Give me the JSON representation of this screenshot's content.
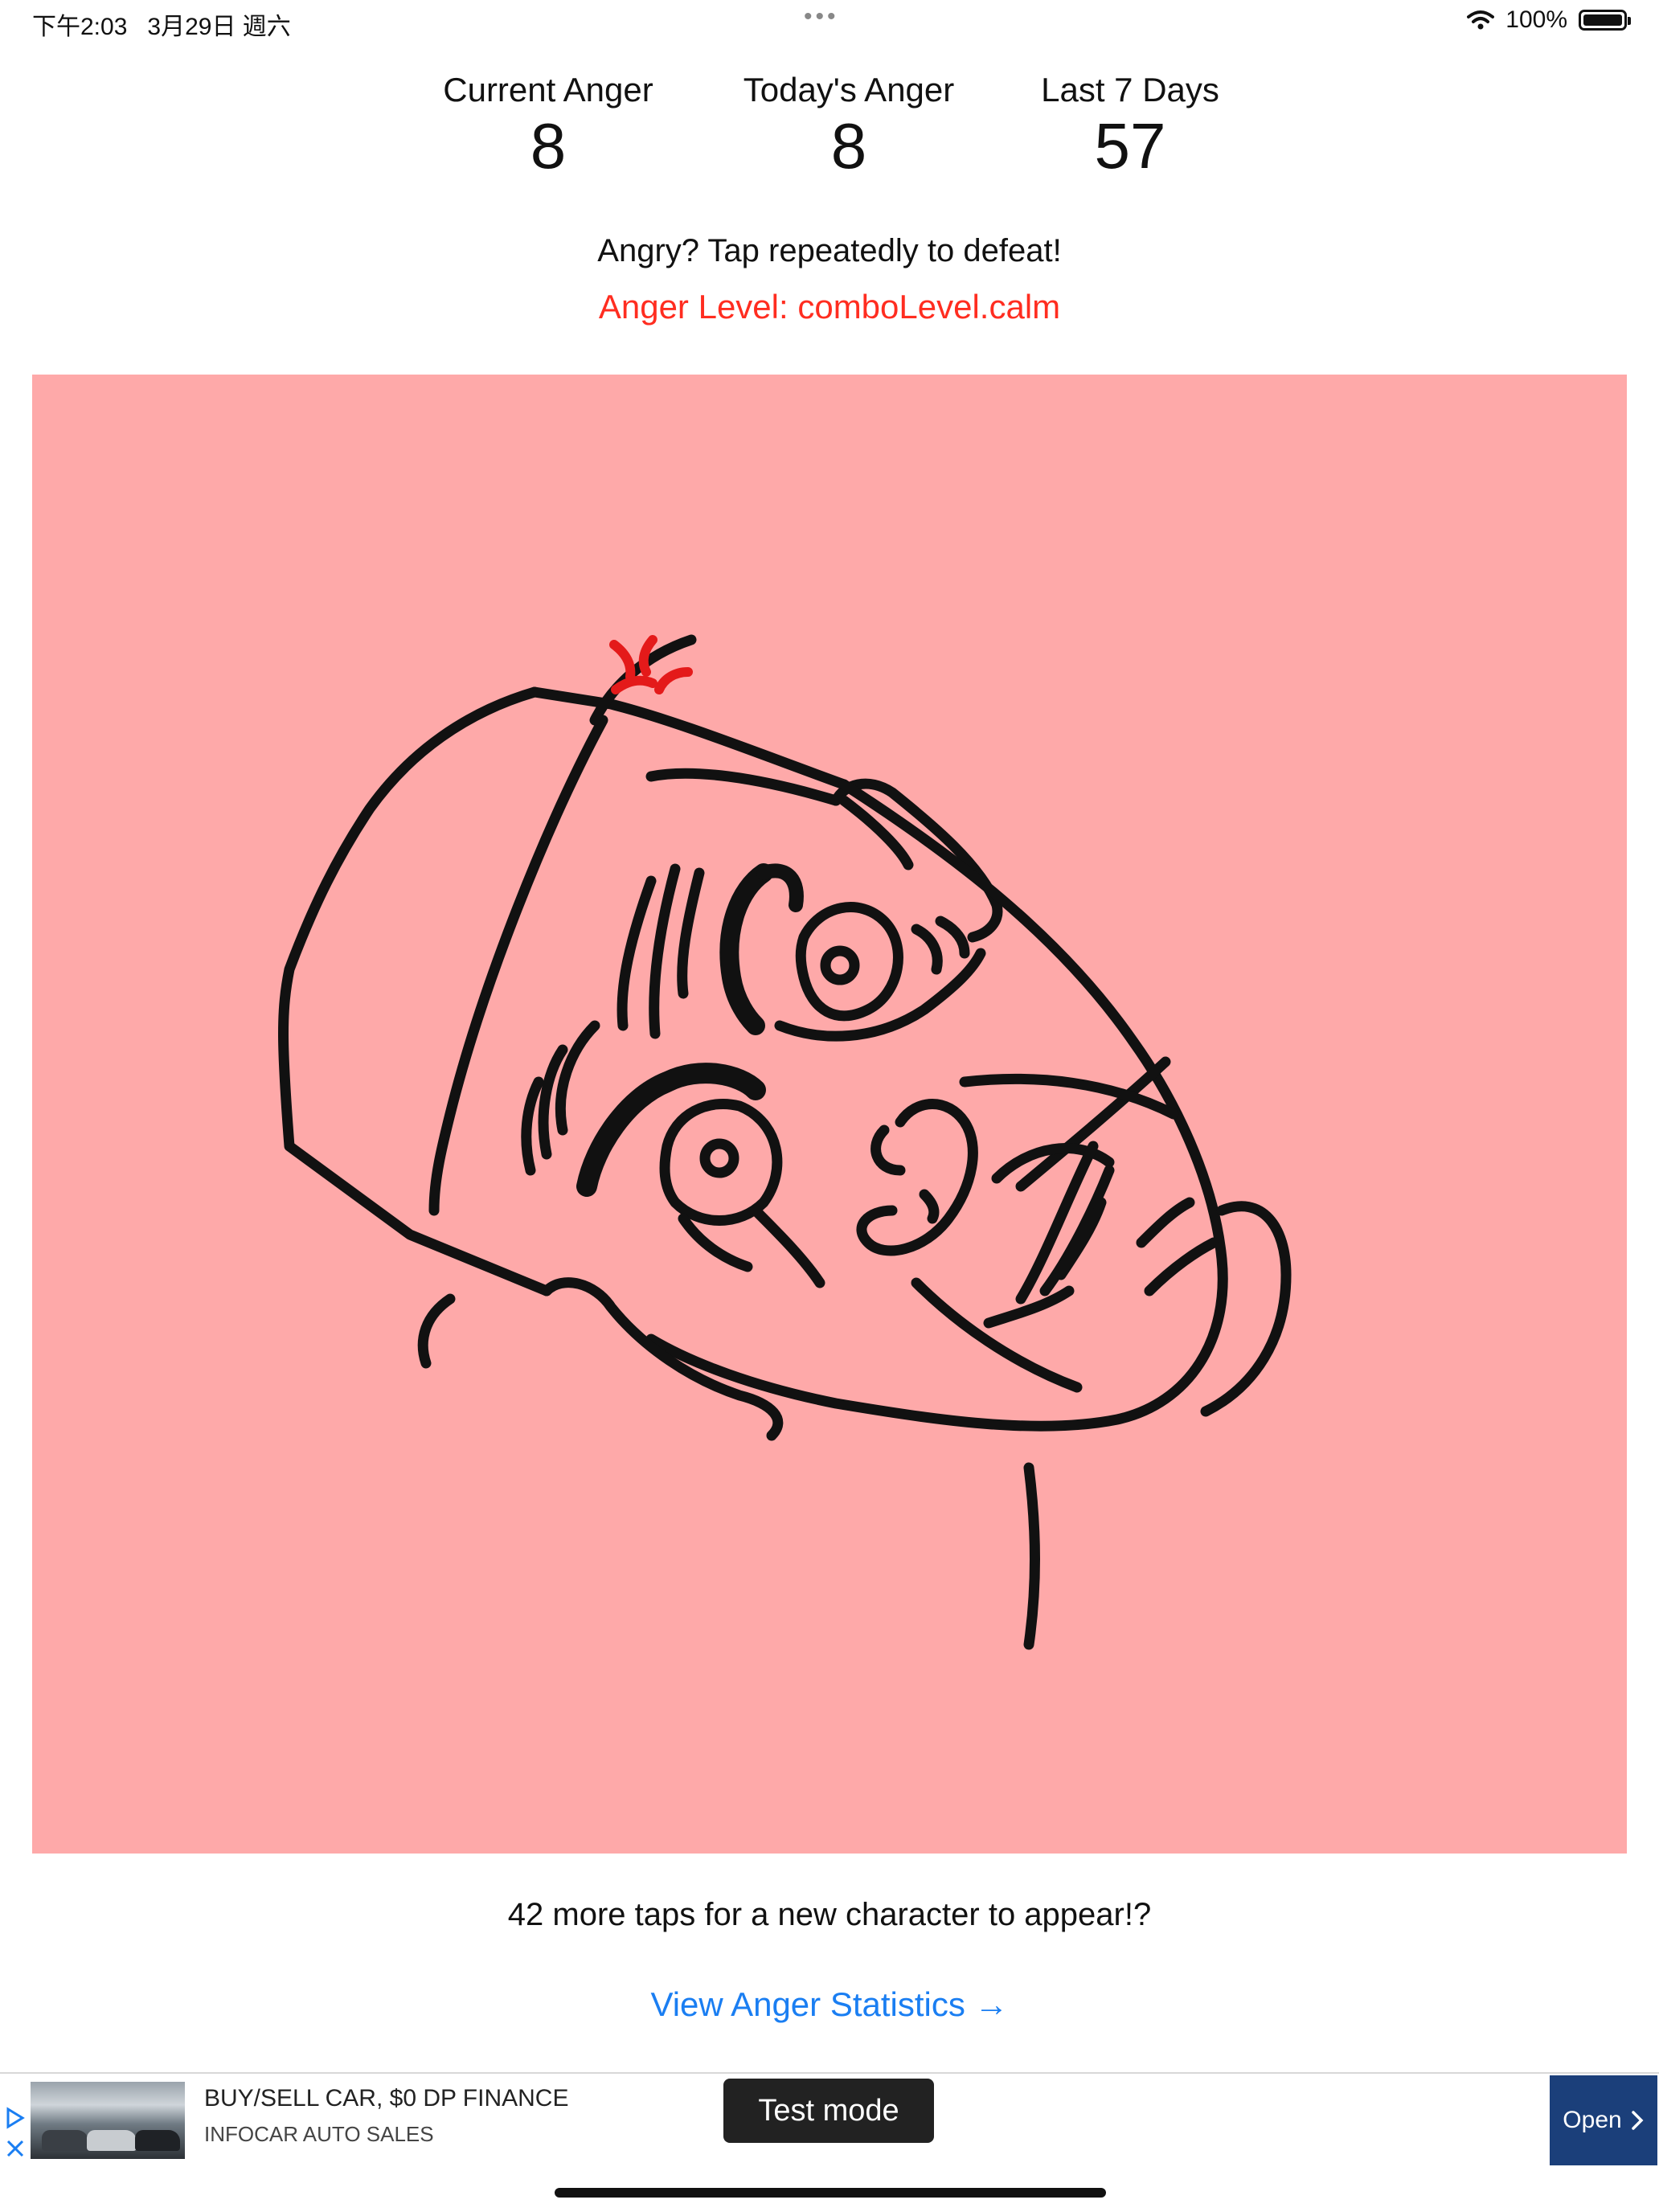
{
  "status_bar": {
    "time_date": "下午2:03   3月29日 週六",
    "dots": "•••",
    "battery": "100%",
    "battery_level": 1.0
  },
  "stats": [
    {
      "label": "Current Anger",
      "value": "8"
    },
    {
      "label": "Today's Anger",
      "value": "8"
    },
    {
      "label": "Last 7 Days",
      "value": "57"
    }
  ],
  "prompt": "Angry? Tap repeatedly to defeat!",
  "anger_level": "Anger Level: comboLevel.calm",
  "colors": {
    "tap_area_bg": "#fea9a9",
    "anger_level_text": "#ff2d20",
    "link": "#1a7ef2",
    "ad_open_bg": "#1b3f7a"
  },
  "taps_message": "42 more taps for a new character to appear!?",
  "stats_link": "View Anger Statistics →",
  "ad": {
    "title": "BUY/SELL CAR, $0 DP FINANCE",
    "subtitle": "INFOCAR AUTO SALES",
    "badge": "Test mode",
    "open_label": "Open",
    "open_icon": "chevron-right-icon",
    "adchoices_icons": [
      "play-triangle-icon",
      "close-x-icon"
    ]
  }
}
